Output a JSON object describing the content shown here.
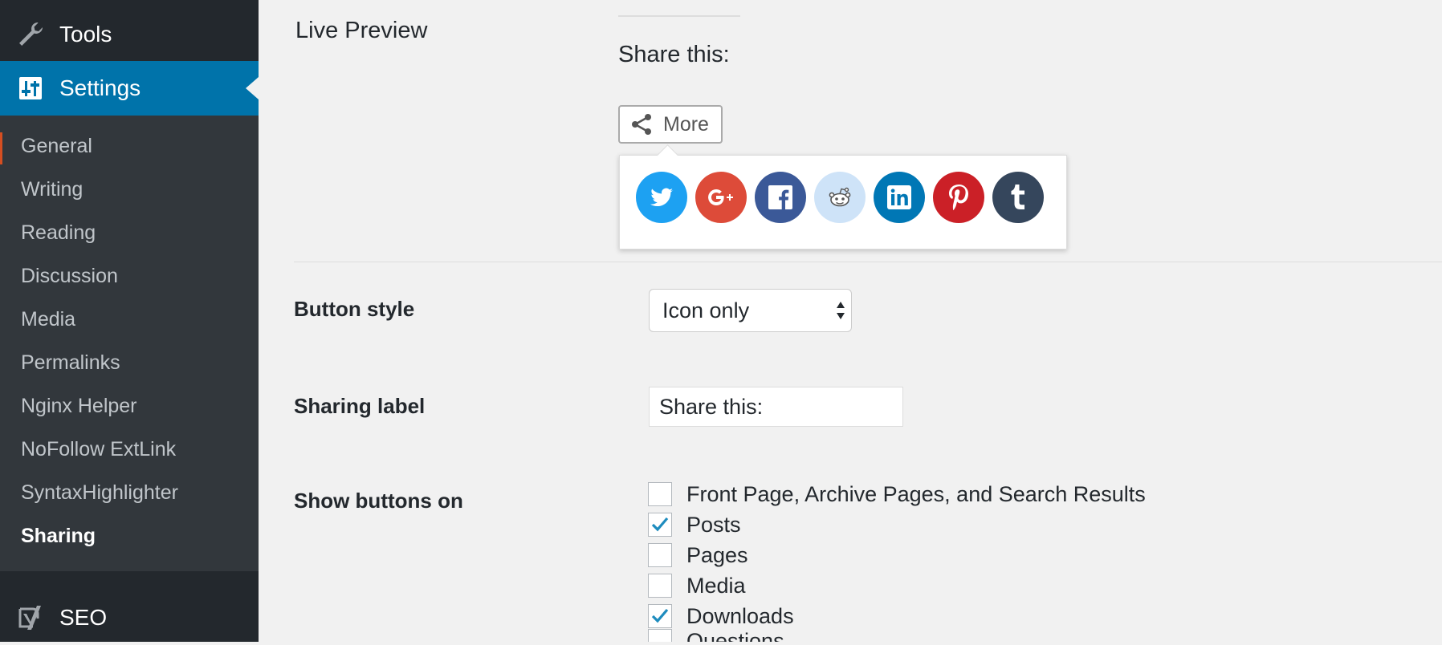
{
  "sidebar": {
    "tools_label": "Tools",
    "settings_label": "Settings",
    "submenu": [
      "General",
      "Writing",
      "Reading",
      "Discussion",
      "Media",
      "Permalinks",
      "Nginx Helper",
      "NoFollow ExtLink",
      "SyntaxHighlighter",
      "Sharing"
    ],
    "current_submenu": "Sharing",
    "seo_label": "SEO"
  },
  "preview": {
    "section_label": "Live Preview",
    "share_title": "Share this:",
    "more_button": "More",
    "services": [
      {
        "name": "twitter",
        "color": "#1da1f2"
      },
      {
        "name": "google-plus",
        "color": "#dd4b39"
      },
      {
        "name": "facebook",
        "color": "#3b5998"
      },
      {
        "name": "reddit",
        "color": "#cee3f8"
      },
      {
        "name": "linkedin",
        "color": "#0077b5"
      },
      {
        "name": "pinterest",
        "color": "#cb2027"
      },
      {
        "name": "tumblr",
        "color": "#35465c"
      }
    ]
  },
  "settings": {
    "button_style_label": "Button style",
    "button_style_value": "Icon only",
    "sharing_label_label": "Sharing label",
    "sharing_label_value": "Share this:",
    "show_buttons_label": "Show buttons on",
    "show_on_options": [
      {
        "label": "Front Page, Archive Pages, and Search Results",
        "checked": false
      },
      {
        "label": "Posts",
        "checked": true
      },
      {
        "label": "Pages",
        "checked": false
      },
      {
        "label": "Media",
        "checked": false
      },
      {
        "label": "Downloads",
        "checked": true
      },
      {
        "label": "Questions",
        "checked": false
      }
    ]
  },
  "colors": {
    "admin_menu": "#23282d",
    "submenu_bg": "#32373c",
    "accent": "#0073aa",
    "content_bg": "#f1f1f1"
  }
}
